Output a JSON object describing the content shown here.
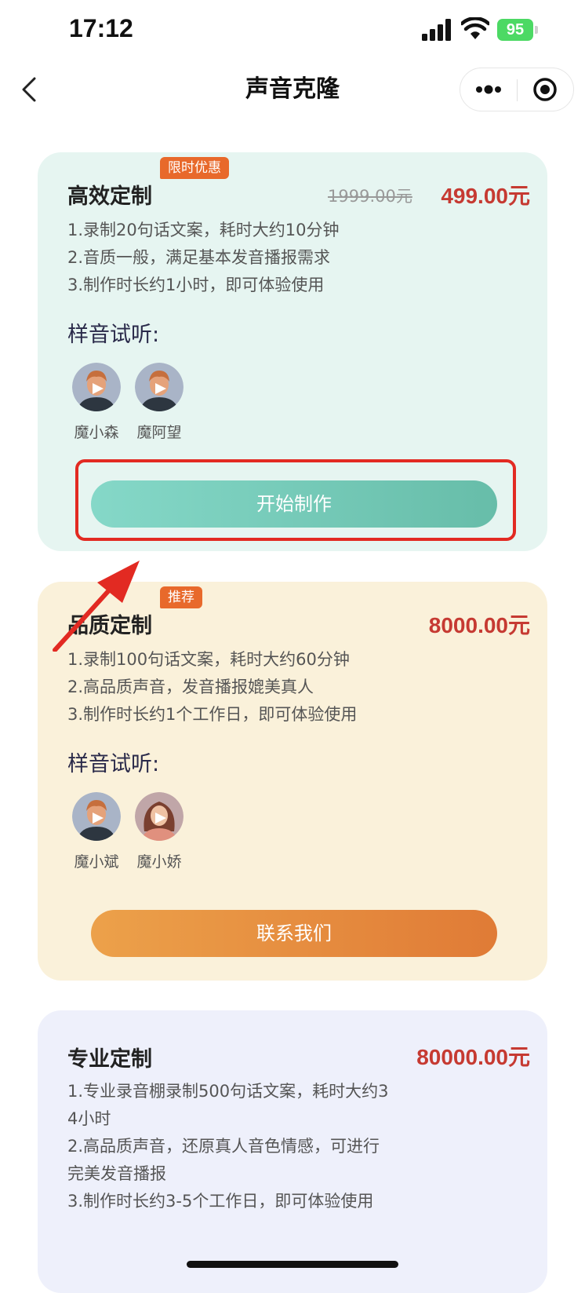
{
  "status_bar": {
    "time": "17:12",
    "battery": "95"
  },
  "nav": {
    "title": "声音克隆"
  },
  "plans": [
    {
      "badge": "限时优惠",
      "title": "高效定制",
      "old_price": "1999.00元",
      "price": "499.00元",
      "desc": [
        "1.录制20句话文案，耗时大约10分钟",
        "2.音质一般，满足基本发音播报需求",
        "3.制作时长约1小时，即可体验使用"
      ],
      "sample_label": "样音试听:",
      "samples": [
        {
          "name": "魔小森",
          "avatar": "male-avatar"
        },
        {
          "name": "魔阿望",
          "avatar": "male-avatar"
        }
      ],
      "cta": "开始制作",
      "accent": "#6cc4b0"
    },
    {
      "badge": "推荐",
      "title": "品质定制",
      "price": "8000.00元",
      "desc": [
        "1.录制100句话文案，耗时大约60分钟",
        "2.高品质声音，发音播报媲美真人",
        "3.制作时长约1个工作日，即可体验使用"
      ],
      "sample_label": "样音试听:",
      "samples": [
        {
          "name": "魔小斌",
          "avatar": "male-avatar"
        },
        {
          "name": "魔小娇",
          "avatar": "female-avatar"
        }
      ],
      "cta": "联系我们",
      "accent": "#e48a3a"
    },
    {
      "title": "专业定制",
      "price": "80000.00元",
      "desc": [
        "1.专业录音棚录制500句话文案，耗时大约3 4小时",
        "2.高品质声音，还原真人音色情感，可进行完美发音播报",
        "3.制作时长约3-5个工作日，即可体验使用"
      ]
    }
  ],
  "colors": {
    "price_red": "#c63a32",
    "badge_orange": "#e8692b",
    "highlight_red": "#e22a22"
  },
  "icons": [
    "back-arrow-icon",
    "more-icon",
    "record-icon",
    "play-icon",
    "signal-icon",
    "wifi-icon",
    "battery-icon",
    "annotation-arrow-icon"
  ]
}
